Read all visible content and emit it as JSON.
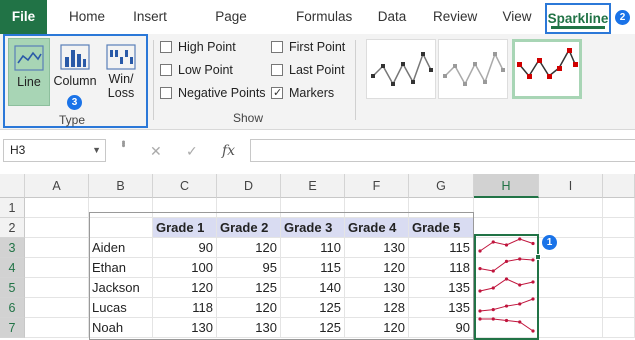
{
  "tabs": {
    "file": "File",
    "home": "Home",
    "insert": "Insert",
    "page_layout": "Page Layout",
    "formulas": "Formulas",
    "data": "Data",
    "review": "Review",
    "view": "View",
    "sparkline": "Sparkline"
  },
  "badges": {
    "one": "1",
    "two": "2",
    "three": "3"
  },
  "type_group": {
    "label": "Type",
    "line": "Line",
    "column": "Column",
    "winloss": "Win/\nLoss"
  },
  "show_group": {
    "label": "Show",
    "high_point": "High Point",
    "low_point": "Low Point",
    "negative_points": "Negative Points",
    "first_point": "First Point",
    "last_point": "Last Point",
    "markers": "Markers"
  },
  "checkbox_states": {
    "high_point": false,
    "low_point": false,
    "negative_points": false,
    "first_point": false,
    "last_point": false,
    "markers": true
  },
  "formula_bar": {
    "name_box": "H3",
    "fx": "fx",
    "cancel": "✕",
    "enter": "✓",
    "formula": ""
  },
  "columns": [
    "A",
    "B",
    "C",
    "D",
    "E",
    "F",
    "G",
    "H",
    "I"
  ],
  "rows": [
    "1",
    "2",
    "3",
    "4",
    "5",
    "6",
    "7"
  ],
  "table": {
    "headers": [
      "Grade 1",
      "Grade 2",
      "Grade 3",
      "Grade 4",
      "Grade 5"
    ],
    "students": [
      {
        "name": "Aiden",
        "grades": [
          90,
          120,
          110,
          130,
          115
        ]
      },
      {
        "name": "Ethan",
        "grades": [
          100,
          95,
          115,
          120,
          118
        ]
      },
      {
        "name": "Jackson",
        "grades": [
          120,
          125,
          140,
          130,
          135
        ]
      },
      {
        "name": "Lucas",
        "grades": [
          118,
          120,
          125,
          128,
          135
        ]
      },
      {
        "name": "Noah",
        "grades": [
          130,
          130,
          125,
          120,
          90
        ]
      }
    ]
  },
  "colors": {
    "accent": "#217346",
    "highlight_blue": "#2b78d8",
    "sparkline": "#c0143c",
    "header_fill": "#d9dcf2"
  }
}
